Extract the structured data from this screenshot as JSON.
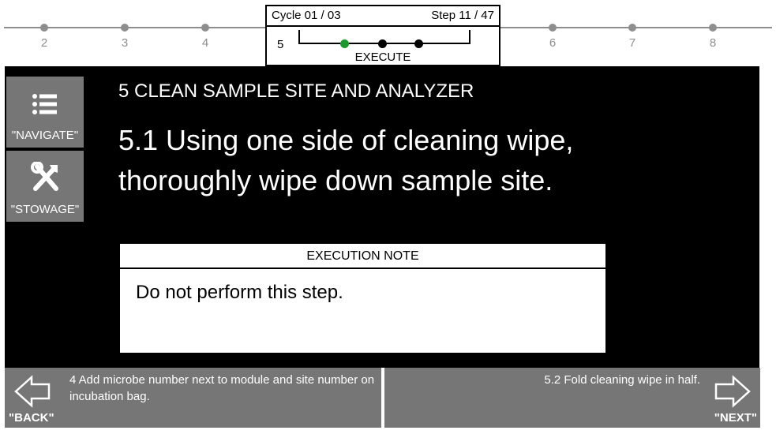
{
  "progress": {
    "steps_left": [
      "2",
      "3",
      "4"
    ],
    "steps_right": [
      "6",
      "7",
      "8"
    ],
    "cycle": "Cycle 01 / 03",
    "step": "Step 11 / 47",
    "current_section": "5",
    "mode": "EXECUTE",
    "colors": {
      "current_substep": "#1a9a2a",
      "track": "#8e8e8e"
    }
  },
  "sidebar": {
    "navigate_label": "\"NAVIGATE\"",
    "navigate_icon": "list-icon",
    "stowage_label": "\"STOWAGE\"",
    "stowage_icon": "tools-icon"
  },
  "main": {
    "section_title": "5 CLEAN SAMPLE SITE AND ANALYZER",
    "step_text": "5.1 Using one side of cleaning wipe, thoroughly wipe down sample site.",
    "note": {
      "header": "EXECUTION NOTE",
      "body": "Do not perform this step."
    }
  },
  "footer": {
    "back": {
      "text": "4 Add microbe number next to module and site number on incubation bag.",
      "key": "\"BACK\"",
      "icon": "arrow-left-icon"
    },
    "next": {
      "text": "5.2 Fold cleaning wipe in half.",
      "key": "\"NEXT\"",
      "icon": "arrow-right-icon"
    }
  }
}
